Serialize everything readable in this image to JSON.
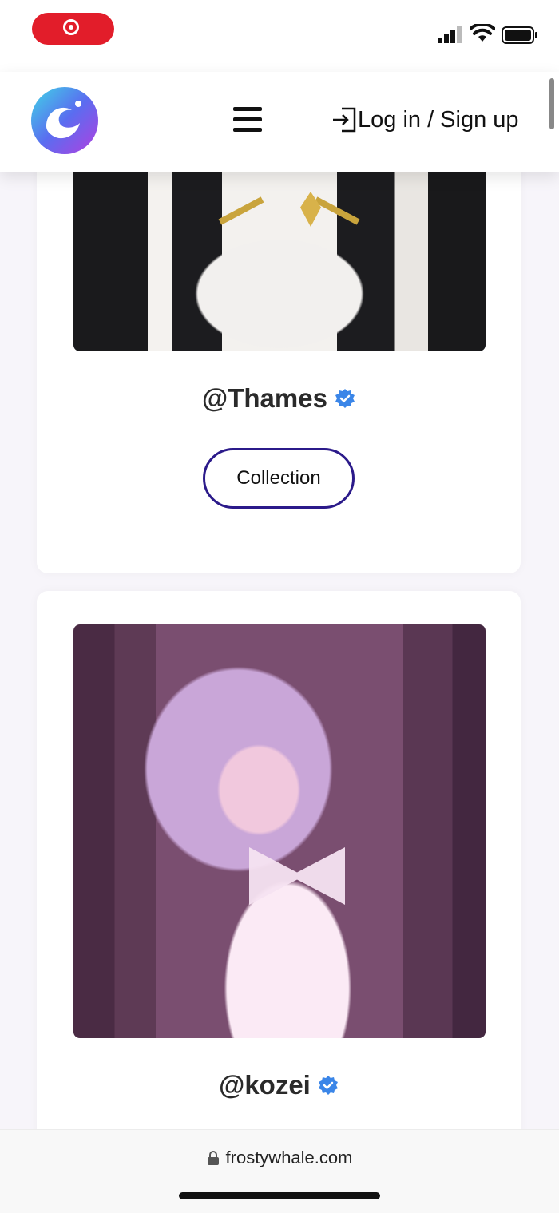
{
  "status_bar": {
    "icons": [
      "screen-record-icon",
      "cellular-signal-icon",
      "wifi-icon",
      "battery-icon"
    ]
  },
  "header": {
    "menu_icon": "hamburger-menu-icon",
    "login_label": "Log in / Sign up",
    "login_icon": "sign-in-icon"
  },
  "cards": [
    {
      "handle": "@Thames",
      "button_label": "Collection"
    },
    {
      "handle": "@kozei"
    }
  ],
  "browser": {
    "url": "frostywhale.com"
  },
  "colors": {
    "record": "#e21d2a",
    "button_border": "#2b1a8a",
    "verified": "#3b86e8"
  }
}
